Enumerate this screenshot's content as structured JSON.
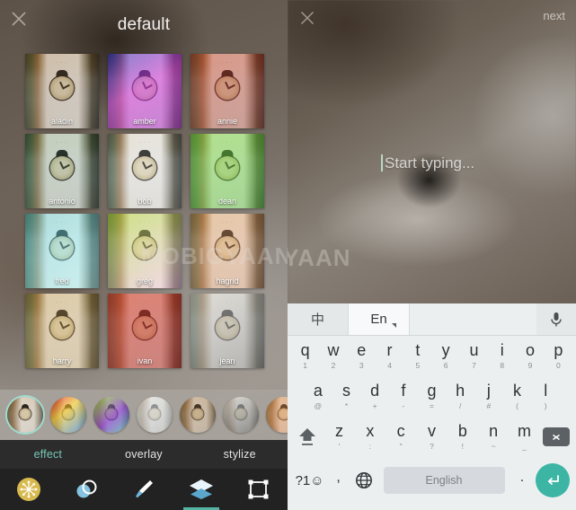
{
  "left_panel": {
    "header": {
      "close_icon": "close-icon",
      "title": "default"
    },
    "filters": [
      {
        "name": "aladin",
        "tint": "linear-gradient(160deg, rgba(120,80,40,.30), rgba(40,30,20,.22))"
      },
      {
        "name": "amber",
        "tint": "linear-gradient(150deg, rgba(40,40,190,.55), rgba(200,60,210,.62) 45%, rgba(150,40,180,.55))"
      },
      {
        "name": "annie",
        "tint": "linear-gradient(150deg, rgba(190,60,40,.48), rgba(130,40,30,.42))"
      },
      {
        "name": "antonio",
        "tint": "linear-gradient(150deg, rgba(60,120,90,.26), rgba(30,60,50,.24))"
      },
      {
        "name": "bob",
        "tint": "linear-gradient(150deg, rgba(190,195,200,.22), rgba(120,125,130,.22))"
      },
      {
        "name": "dean",
        "tint": "linear-gradient(150deg, rgba(120,215,70,.52), rgba(70,170,50,.48))"
      },
      {
        "name": "fred",
        "tint": "linear-gradient(150deg, rgba(90,200,215,.45), rgba(140,225,230,.42))"
      },
      {
        "name": "greg",
        "tint": "linear-gradient(150deg, rgba(175,215,60,.55), rgba(230,170,215,.42))"
      },
      {
        "name": "hagrid",
        "tint": "linear-gradient(150deg, rgba(215,150,95,.42), rgba(180,110,70,.38))"
      },
      {
        "name": "harry",
        "tint": "linear-gradient(150deg, rgba(185,150,80,.38), rgba(150,115,55,.34))"
      },
      {
        "name": "ivan",
        "tint": "linear-gradient(150deg, rgba(210,60,45,.60), rgba(160,35,30,.55))"
      },
      {
        "name": "jean",
        "tint": "linear-gradient(150deg, rgba(210,210,210,.55), rgba(120,120,120,.55))"
      }
    ],
    "filmstrip": [
      {
        "name": "strip-thumb-1",
        "selected": true,
        "tint": "linear-gradient(150deg, rgba(120,80,40,.20), rgba(40,30,20,.15))"
      },
      {
        "name": "strip-thumb-2",
        "selected": false,
        "tint": "linear-gradient(140deg, rgba(230,30,40,.70), rgba(240,200,40,.62) 40%, rgba(40,120,220,.65))"
      },
      {
        "name": "strip-thumb-3",
        "selected": false,
        "tint": "linear-gradient(140deg, rgba(140,215,45,.72), rgba(120,40,200,.66) 55%, rgba(30,170,150,.6))"
      },
      {
        "name": "strip-thumb-4",
        "selected": false,
        "tint": "linear-gradient(150deg, rgba(225,228,230,.66), rgba(170,175,178,.6))"
      },
      {
        "name": "strip-thumb-5",
        "selected": false,
        "tint": "linear-gradient(150deg, rgba(150,105,60,.38), rgba(95,65,35,.34))"
      },
      {
        "name": "strip-thumb-6",
        "selected": false,
        "tint": "linear-gradient(150deg, rgba(210,210,210,.70), rgba(70,70,70,.60))"
      },
      {
        "name": "strip-thumb-7",
        "selected": false,
        "tint": "linear-gradient(150deg, rgba(215,135,70,.48), rgba(180,95,45,.42))"
      }
    ],
    "tabs": [
      {
        "label": "effect",
        "active": true
      },
      {
        "label": "overlay",
        "active": false
      },
      {
        "label": "stylize",
        "active": false
      }
    ],
    "toolbar": [
      {
        "icon": "snowflake-badge-icon",
        "active": false
      },
      {
        "icon": "contrast-circles-icon",
        "active": false
      },
      {
        "icon": "brush-icon",
        "active": false
      },
      {
        "icon": "layers-icon",
        "active": true
      },
      {
        "icon": "crop-transform-icon",
        "active": false
      }
    ],
    "watermark": "MOBIGYAAN"
  },
  "right_panel": {
    "header": {
      "close_icon": "close-icon",
      "next_label": "next"
    },
    "text_input": {
      "placeholder": "Start typing...",
      "value": ""
    },
    "watermark_fragment": "GYAAN",
    "keyboard": {
      "language_bar": {
        "chinese_label": "中",
        "english_label": "En",
        "mic_icon": "microphone-icon",
        "active": "En"
      },
      "row1": [
        {
          "main": "q",
          "sub": "1"
        },
        {
          "main": "w",
          "sub": "2"
        },
        {
          "main": "e",
          "sub": "3"
        },
        {
          "main": "r",
          "sub": "4"
        },
        {
          "main": "t",
          "sub": "5"
        },
        {
          "main": "y",
          "sub": "6"
        },
        {
          "main": "u",
          "sub": "7"
        },
        {
          "main": "i",
          "sub": "8"
        },
        {
          "main": "o",
          "sub": "9"
        },
        {
          "main": "p",
          "sub": "0"
        }
      ],
      "row2": [
        {
          "main": "a",
          "sub": "@"
        },
        {
          "main": "s",
          "sub": "*"
        },
        {
          "main": "d",
          "sub": "+"
        },
        {
          "main": "f",
          "sub": "-"
        },
        {
          "main": "g",
          "sub": "="
        },
        {
          "main": "h",
          "sub": "/"
        },
        {
          "main": "j",
          "sub": "#"
        },
        {
          "main": "k",
          "sub": "("
        },
        {
          "main": "l",
          "sub": ")"
        }
      ],
      "row3": {
        "shift_icon": "shift-icon",
        "keys": [
          {
            "main": "z",
            "sub": "'"
          },
          {
            "main": "x",
            "sub": ":"
          },
          {
            "main": "c",
            "sub": "\""
          },
          {
            "main": "v",
            "sub": "?"
          },
          {
            "main": "b",
            "sub": "!"
          },
          {
            "main": "n",
            "sub": "~"
          },
          {
            "main": "m",
            "sub": "_"
          }
        ],
        "backspace_icon": "backspace-icon"
      },
      "row4": {
        "symbols_label": "?1☺",
        "comma_label": ",",
        "globe_icon": "globe-icon",
        "space_label": "English",
        "period_label": ".",
        "enter_icon": "enter-icon"
      }
    }
  },
  "colors": {
    "accent_teal": "#3cb5a5",
    "tab_active": "#76c7b4",
    "toolbar_bg": "#222222",
    "tabbar_bg": "#2c2c2c",
    "keyboard_bg": "#eceff0"
  }
}
